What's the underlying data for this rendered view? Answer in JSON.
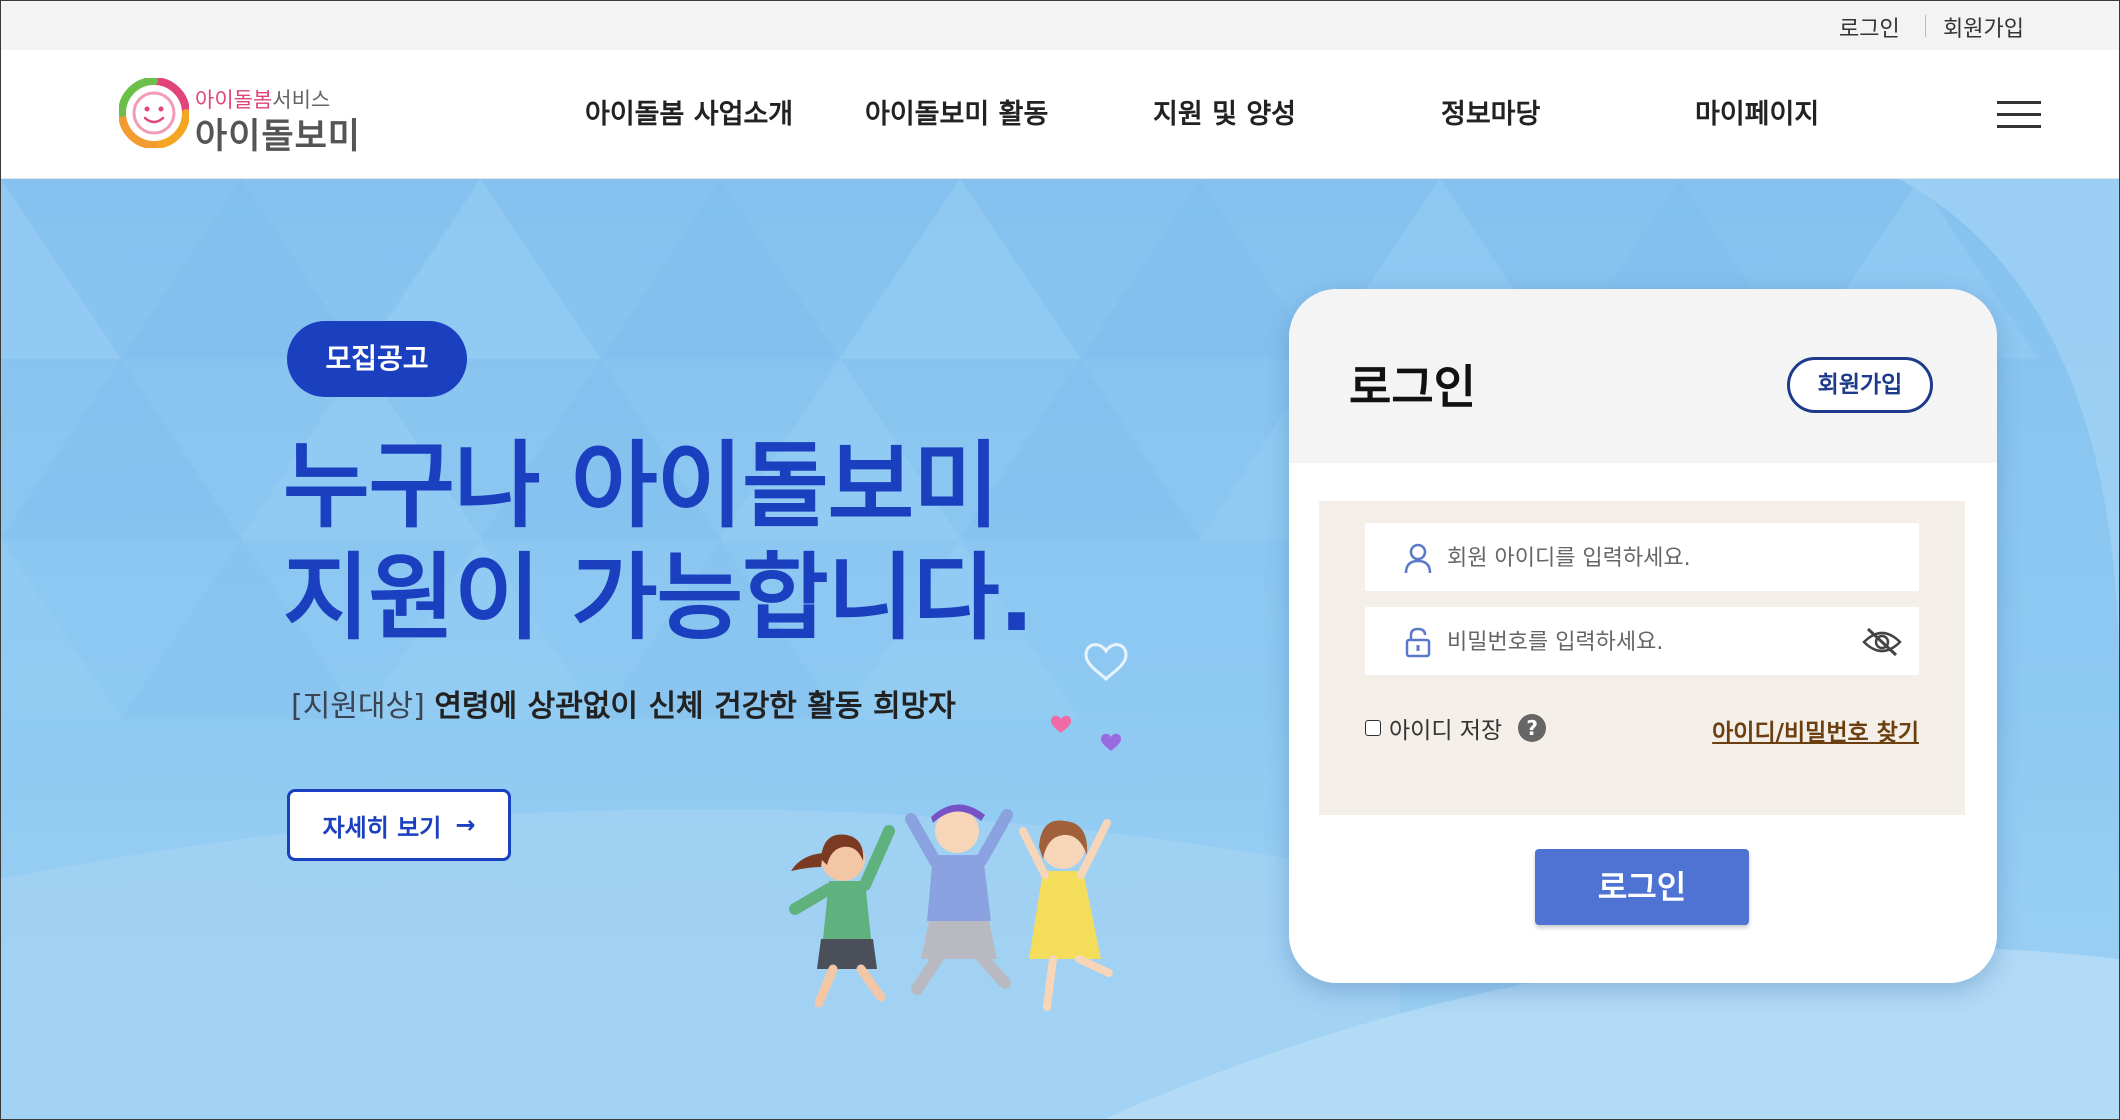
{
  "utility": {
    "login": "로그인",
    "signup": "회원가입"
  },
  "logo": {
    "sub_highlight": "아이돌봄",
    "sub_rest": "서비스",
    "main": "아이돌보미"
  },
  "nav": [
    "아이돌봄 사업소개",
    "아이돌보미 활동",
    "지원 및 양성",
    "정보마당",
    "마이페이지"
  ],
  "hero": {
    "badge": "모집공고",
    "headline_line1": "누구나 아이돌보미",
    "headline_line2": "지원이 가능합니다.",
    "sub_prefix": "[지원대상]",
    "sub_text": "연령에 상관없이 신체 건강한 활동 희망자",
    "more_label": "자세히 보기",
    "more_arrow": "→"
  },
  "login": {
    "title": "로그인",
    "signup_label": "회원가입",
    "id_placeholder": "회원 아이디를 입력하세요.",
    "pw_placeholder": "비밀번호를 입력하세요.",
    "save_id_label": "아이디 저장",
    "help_glyph": "?",
    "find_label": "아이디/비밀번호 찾기",
    "submit_label": "로그인"
  },
  "icons": {
    "user": "user-icon",
    "lock": "lock-icon",
    "eye_off": "eye-off-icon",
    "menu": "hamburger-menu-icon",
    "help": "help-icon",
    "arrow": "arrow-right-icon"
  },
  "colors": {
    "brand_blue": "#1a3fbf",
    "login_button": "#4f73d3",
    "hero_bg": "#8ec9f2",
    "find_link": "#6b3f10",
    "form_bg": "#f4efe8"
  }
}
